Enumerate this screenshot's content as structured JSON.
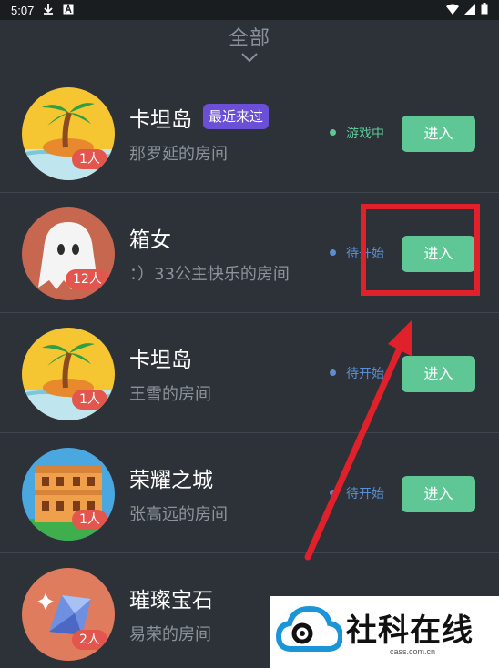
{
  "status_bar": {
    "time": "5:07"
  },
  "header": {
    "filter_label": "全部"
  },
  "rooms": [
    {
      "name": "卡坦岛",
      "tag": "最近来过",
      "owner": "那罗延的房间",
      "count": "1人",
      "status": "游戏中",
      "status_color": "#5fc796",
      "enter": "进入",
      "avatar": "palm-island-icon"
    },
    {
      "name": "箱女",
      "tag": "",
      "owner": "：）33公主快乐的房间",
      "count": "12人",
      "status": "待开始",
      "status_color": "#5b8fd1",
      "enter": "进入",
      "avatar": "ghost-icon"
    },
    {
      "name": "卡坦岛",
      "tag": "",
      "owner": "王雪的房间",
      "count": "1人",
      "status": "待开始",
      "status_color": "#5b8fd1",
      "enter": "进入",
      "avatar": "palm-island-icon"
    },
    {
      "name": "荣耀之城",
      "tag": "",
      "owner": "张高远的房间",
      "count": "1人",
      "status": "待开始",
      "status_color": "#5b8fd1",
      "enter": "进入",
      "avatar": "castle-icon"
    },
    {
      "name": "璀璨宝石",
      "tag": "",
      "owner": "易荣的房间",
      "count": "2人",
      "status": "",
      "status_color": "#5b8fd1",
      "enter": "",
      "avatar": "gem-icon"
    }
  ],
  "watermark": {
    "title": "社科在线",
    "domain": "cass.com.cn"
  },
  "colors": {
    "accent_green": "#5fc796",
    "highlight_red": "#e0202a",
    "tag_purple": "#6b4fd6"
  }
}
